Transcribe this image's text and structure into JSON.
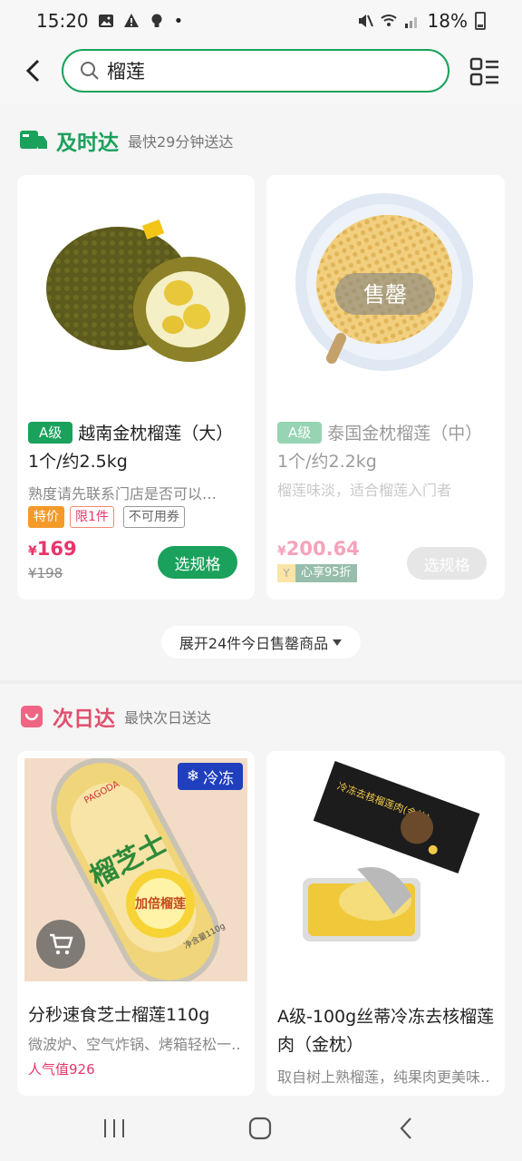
{
  "status_bar": {
    "time": "15:20",
    "battery_text": "18%"
  },
  "search": {
    "value": "榴莲"
  },
  "sections": [
    {
      "title": "及时达",
      "subtitle": "最快29分钟送达"
    },
    {
      "title": "次日达",
      "subtitle": "最快次日送达"
    }
  ],
  "products_same_day": [
    {
      "grade": "A级",
      "name": "越南金枕榴莲（大） 1个/约2.5kg",
      "desc": "熟度请先联系门店是否可以…",
      "tags": [
        "特价",
        "限1件",
        "不可用券"
      ],
      "price_symbol": "¥",
      "price": "169",
      "old_price": "¥198",
      "button": "选规格"
    },
    {
      "grade": "A级",
      "name": "泰国金枕榴莲（中） 1个/约2.2kg",
      "desc": "榴莲味淡，适合榴莲入门者",
      "sold_out_label": "售罄",
      "price_symbol": "¥",
      "price": "200.64",
      "member_discount": "心享95折",
      "button": "选规格"
    }
  ],
  "expand_label": "展开24件今日售罄商品",
  "products_next_day": [
    {
      "badge": "冷冻",
      "name": "分秒速食芝士榴莲110g",
      "desc": "微波炉、空气炸锅、烤箱轻松一…",
      "popularity": "人气值926",
      "package_text": "榴芝士",
      "package_sub": "加倍榴莲",
      "package_net": "净含量110g",
      "brand_small": "PAGODA"
    },
    {
      "name": "A级-100g丝蒂冷冻去核榴莲肉（金枕）",
      "desc": "取自树上熟榴莲，纯果肉更美味…",
      "box_text": "冷冻去核榴莲肉(金枕)"
    }
  ],
  "colors": {
    "accent_green": "#1aa15b",
    "price_red": "#e8356a",
    "next_day_pink": "#e0506e",
    "frozen_blue": "#1f3fbf"
  }
}
